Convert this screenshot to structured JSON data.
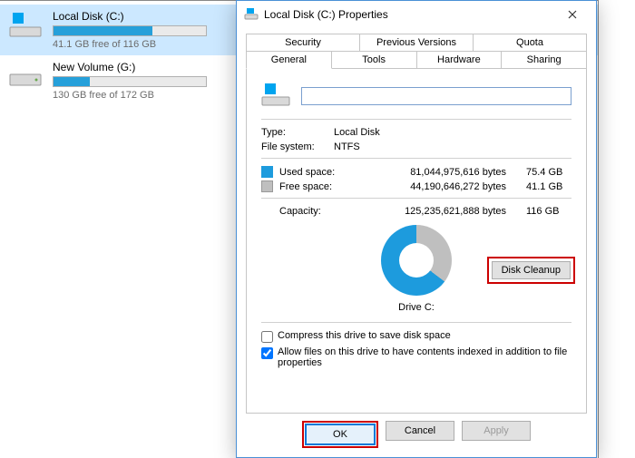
{
  "explorer": {
    "drives": [
      {
        "name": "Local Disk (C:)",
        "subtitle": "41.1 GB free of 116 GB",
        "used_pct": 65,
        "selected": true,
        "icon": "drive-windows-icon"
      },
      {
        "name": "New Volume (G:)",
        "subtitle": "130 GB free of 172 GB",
        "used_pct": 24,
        "selected": false,
        "icon": "drive-icon"
      }
    ]
  },
  "dialog": {
    "title": "Local Disk (C:) Properties",
    "tabs_top": [
      "Security",
      "Previous Versions",
      "Quota"
    ],
    "tabs_bottom": [
      "General",
      "Tools",
      "Hardware",
      "Sharing"
    ],
    "active_tab": "General",
    "name_value": "",
    "type_label": "Type:",
    "type_value": "Local Disk",
    "fs_label": "File system:",
    "fs_value": "NTFS",
    "used_label": "Used space:",
    "used_bytes": "81,044,975,616 bytes",
    "used_human": "75.4 GB",
    "free_label": "Free space:",
    "free_bytes": "44,190,646,272 bytes",
    "free_human": "41.1 GB",
    "cap_label": "Capacity:",
    "cap_bytes": "125,235,621,888 bytes",
    "cap_human": "116 GB",
    "drive_caption": "Drive C:",
    "cleanup_label": "Disk Cleanup",
    "compress_label": "Compress this drive to save disk space",
    "compress_checked": false,
    "index_label": "Allow files on this drive to have contents indexed in addition to file properties",
    "index_checked": true,
    "ok_label": "OK",
    "cancel_label": "Cancel",
    "apply_label": "Apply"
  },
  "colors": {
    "used": "#1D9BDD",
    "free": "#bfbfbf",
    "accent": "#0078d7",
    "highlight": "#c00"
  }
}
